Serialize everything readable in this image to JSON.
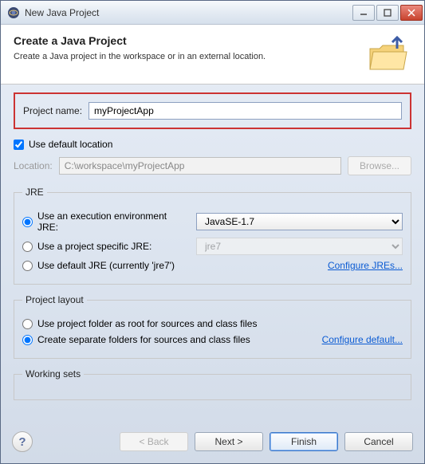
{
  "window": {
    "title": "New Java Project"
  },
  "header": {
    "title": "Create a Java Project",
    "description": "Create a Java project in the workspace or in an external location."
  },
  "project": {
    "name_label": "Project name:",
    "name_value": "myProjectApp"
  },
  "default_location": {
    "checkbox_label": "Use default location",
    "checked": true,
    "location_label": "Location:",
    "location_value": "C:\\workspace\\myProjectApp",
    "browse_label": "Browse..."
  },
  "jre": {
    "legend": "JRE",
    "options": {
      "exec_env_label": "Use an execution environment JRE:",
      "exec_env_value": "JavaSE-1.7",
      "project_specific_label": "Use a project specific JRE:",
      "project_specific_value": "jre7",
      "default_jre_label": "Use default JRE (currently 'jre7')"
    },
    "configure_link": "Configure JREs..."
  },
  "project_layout": {
    "legend": "Project layout",
    "options": {
      "root_label": "Use project folder as root for sources and class files",
      "separate_label": "Create separate folders for sources and class files"
    },
    "configure_link": "Configure default..."
  },
  "working_sets": {
    "legend": "Working sets"
  },
  "footer": {
    "back_label": "< Back",
    "next_label": "Next >",
    "finish_label": "Finish",
    "cancel_label": "Cancel"
  }
}
